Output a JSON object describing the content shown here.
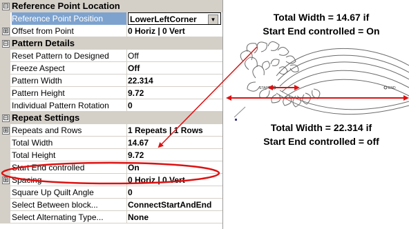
{
  "properties": {
    "cat_reference": "Reference Point Location",
    "ref_position_label": "Reference Point Position",
    "ref_position_value": "LowerLeftCorner",
    "offset_label": "Offset from Point",
    "offset_value": "0 Horiz | 0 Vert",
    "cat_pattern": "Pattern Details",
    "reset_label": "Reset Pattern to Designed",
    "reset_value": "Off",
    "freeze_label": "Freeze Aspect",
    "freeze_value": "Off",
    "pwidth_label": "Pattern Width",
    "pwidth_value": "22.314",
    "pheight_label": "Pattern Height",
    "pheight_value": "9.72",
    "rotation_label": "Individual Pattern Rotation",
    "rotation_value": "0",
    "cat_repeat": "Repeat Settings",
    "repeats_label": "Repeats and Rows",
    "repeats_value": "1 Repeats | 1 Rows",
    "twidth_label": "Total Width",
    "twidth_value": "14.67",
    "theight_label": "Total Height",
    "theight_value": "9.72",
    "startend_label": "Start End controlled",
    "startend_value": "On",
    "spacing_label": "Spacing",
    "spacing_value": "0 Horiz | 0 Vert",
    "squareup_label": "Square Up Quilt Angle",
    "squareup_value": "0",
    "selectbetween_label": "Select Between block...",
    "selectbetween_value": "ConnectStartAndEnd",
    "selectalt_label": "Select Alternating Type...",
    "selectalt_value": "None"
  },
  "icons": {
    "collapse": "⊟",
    "expand": "⊞",
    "dropdown": "▼"
  },
  "annotations": {
    "top_line1": "Total Width = 14.67 if",
    "top_line2": "Start End controlled = On",
    "bottom_line1": "Total Width = 22.314 if",
    "bottom_line2": "Start End controlled = off"
  },
  "preview": {
    "start_label": "START",
    "end_label": "END"
  },
  "colors": {
    "accent": "#dd1111",
    "selection": "#7da2ce",
    "grid_gutter": "#d4d0c8"
  }
}
